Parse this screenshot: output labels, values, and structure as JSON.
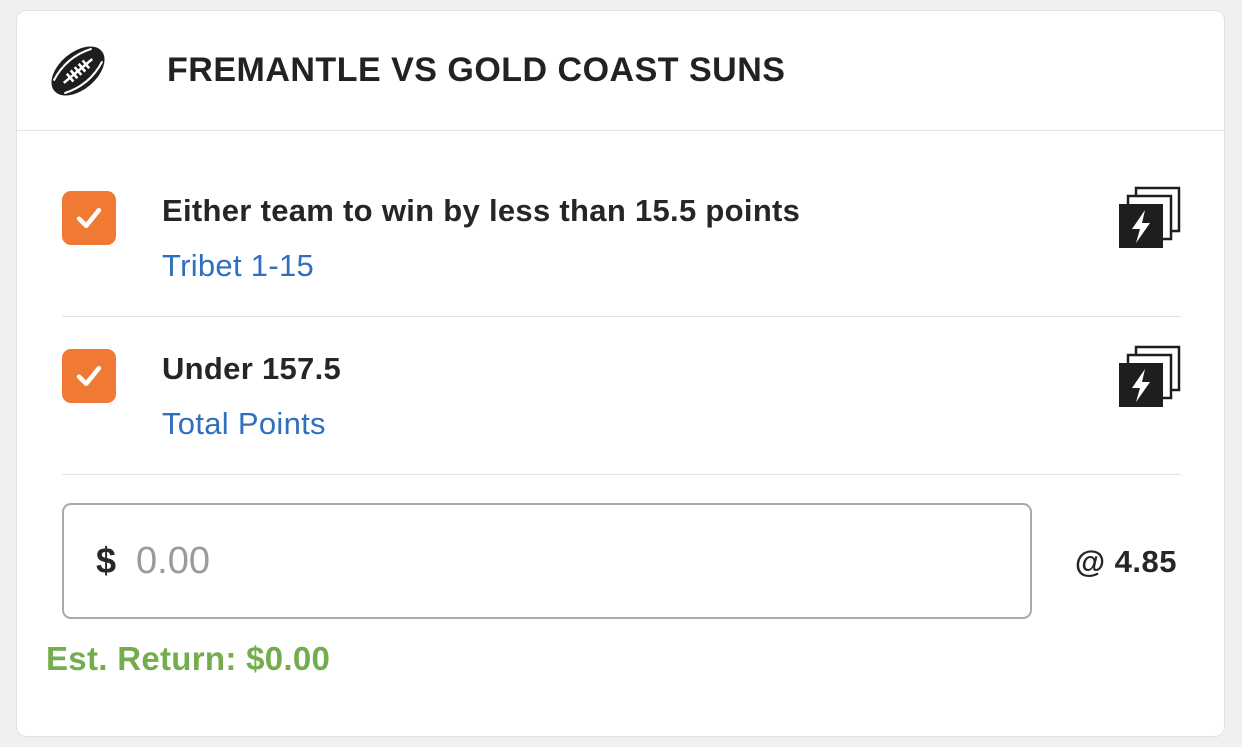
{
  "header": {
    "icon": "rugby-ball-icon",
    "title": "FREMANTLE VS GOLD COAST SUNS"
  },
  "bets": [
    {
      "checked": true,
      "selection": "Either team to win by less than 15.5 points",
      "market": "Tribet 1-15",
      "icon": "same-game-multi-icon"
    },
    {
      "checked": true,
      "selection": "Under 157.5",
      "market": "Total Points",
      "icon": "same-game-multi-icon"
    }
  ],
  "stake": {
    "currency": "$",
    "value": "",
    "placeholder": "0.00",
    "odds": "@ 4.85"
  },
  "est_return": "Est. Return: $0.00",
  "colors": {
    "checkbox": "#f07a34",
    "market_link": "#2f6fbf",
    "est_return": "#73ad4d"
  }
}
